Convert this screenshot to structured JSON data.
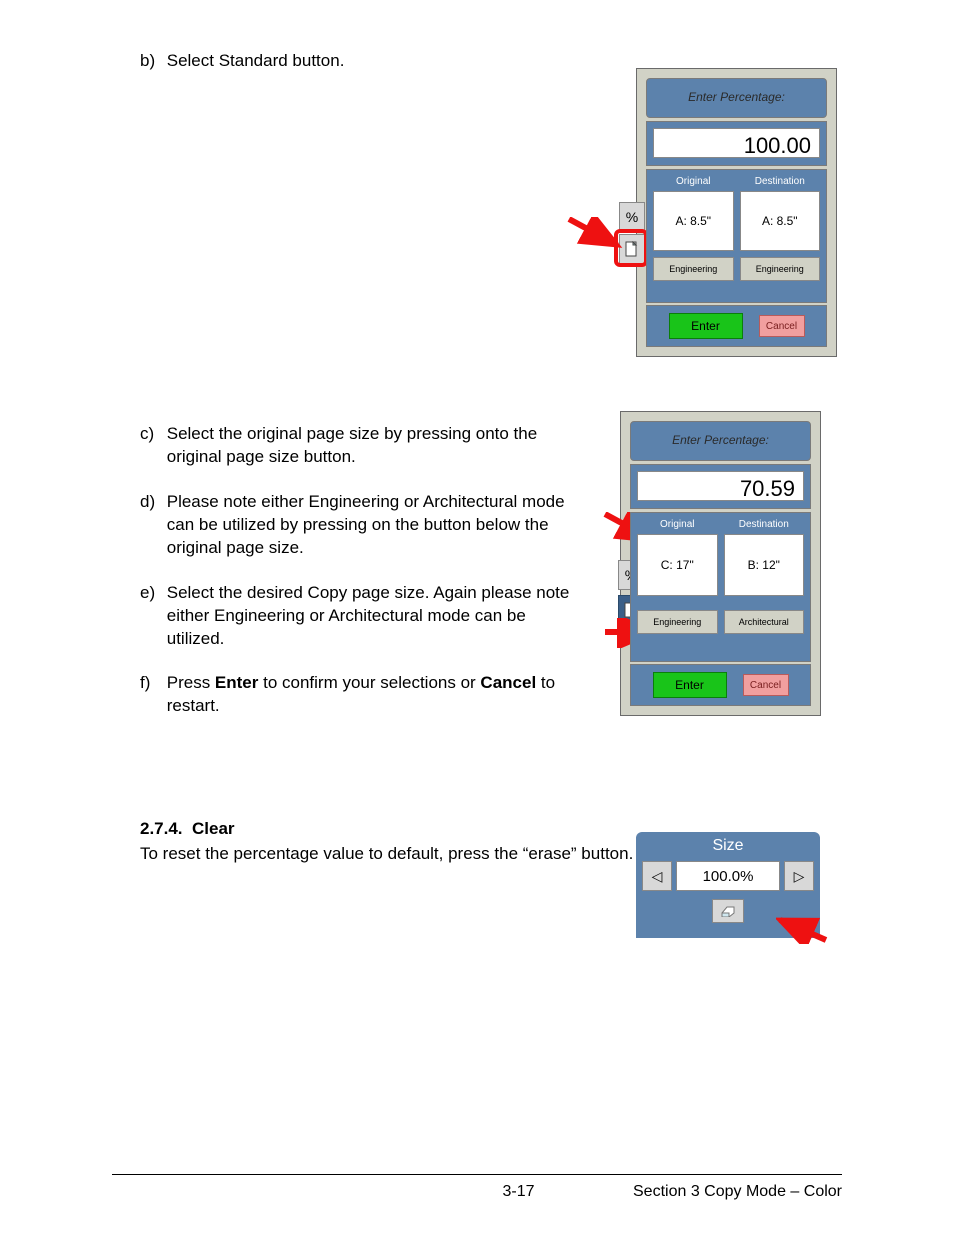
{
  "steps": {
    "b": {
      "label": "b)",
      "text": "Select Standard button."
    },
    "c": {
      "label": "c)",
      "text": "Select the original page size by pressing onto the original page size button."
    },
    "d": {
      "label": "d)",
      "text": "Please note either Engineering or Architectural mode can be utilized by pressing on the button below the original page size."
    },
    "e": {
      "label": "e)",
      "text": "Select the desired Copy page size. Again please note either Engineering or Architectural mode can be utilized."
    },
    "f": {
      "label": "f)",
      "text_pre": "Press ",
      "bold1": "Enter",
      "text_mid": " to confirm your selections or ",
      "bold2": "Cancel",
      "text_post": " to restart."
    }
  },
  "section": {
    "num": "2.7.4.",
    "title": "Clear",
    "body": "To reset the percentage value to default, press the “erase” button."
  },
  "panel1": {
    "title": "Enter Percentage:",
    "value": "100.00",
    "orig_hdr": "Original",
    "dest_hdr": "Destination",
    "orig_val": "A: 8.5\"",
    "dest_val": "A: 8.5\"",
    "orig_mode": "Engineering",
    "dest_mode": "Engineering",
    "percent": "%",
    "enter": "Enter",
    "cancel": "Cancel"
  },
  "panel2": {
    "title": "Enter Percentage:",
    "value": "70.59",
    "orig_hdr": "Original",
    "dest_hdr": "Destination",
    "orig_val": "C: 17\"",
    "dest_val": "B: 12\"",
    "orig_mode": "Engineering",
    "dest_mode": "Architectural",
    "percent": "%",
    "enter": "Enter",
    "cancel": "Cancel"
  },
  "size_widget": {
    "title": "Size",
    "value": "100.0%"
  },
  "footer": {
    "page": "3-17",
    "section": "Section 3    Copy Mode – Color"
  }
}
